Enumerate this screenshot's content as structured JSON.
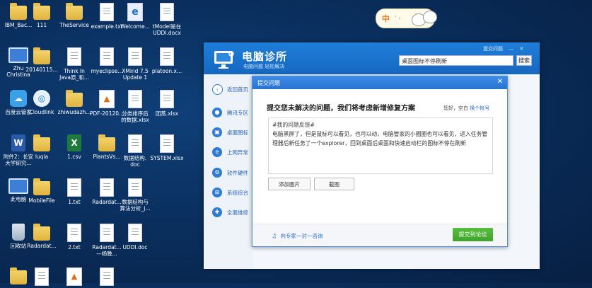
{
  "desktop": {
    "icons": [
      {
        "label": "IBM_Bac...",
        "kind": "folder",
        "icon": "folder-icon"
      },
      {
        "label": "111",
        "kind": "folder",
        "icon": "folder-icon"
      },
      {
        "label": "TheService",
        "kind": "folder",
        "icon": "folder-icon"
      },
      {
        "label": "example.txt",
        "kind": "doc",
        "icon": "text-file-icon"
      },
      {
        "label": "Welcome...",
        "kind": "docblue",
        "icon": "word-document-icon"
      },
      {
        "label": "tModel是在\nUDDI.docx",
        "kind": "doc",
        "icon": "docx-file-icon"
      },
      {
        "label": "Zhu\nChristina",
        "kind": "monitor",
        "icon": "user-folder-icon"
      },
      {
        "label": "20140115...",
        "kind": "folder",
        "icon": "folder-icon"
      },
      {
        "label": "Think In\nJava原_和...",
        "kind": "doc",
        "icon": "file-icon"
      },
      {
        "label": "myeclipse...",
        "kind": "doc",
        "icon": "file-icon"
      },
      {
        "label": "XMind 7.5\nUpdate 1",
        "kind": "doc",
        "icon": "xmind-icon"
      },
      {
        "label": "platoon.x...",
        "kind": "doc",
        "icon": "file-icon"
      },
      {
        "label": "百度云管家",
        "kind": "cloud",
        "icon": "baidu-cloud-icon"
      },
      {
        "label": "Cloudlink",
        "kind": "cloudlink",
        "icon": "cloudlink-icon"
      },
      {
        "label": "zhiwudazh...",
        "kind": "folder",
        "icon": "folder-icon"
      },
      {
        "label": "PDF-20120...",
        "kind": "pdf",
        "icon": "pdf-icon"
      },
      {
        "label": "分类排序后\n的数据.xlsx",
        "kind": "doc",
        "icon": "xlsx-file-icon"
      },
      {
        "label": "团蒸.xlsx",
        "kind": "doc",
        "icon": "xlsx-file-icon"
      },
      {
        "label": "附件2：长安\n大学研究...",
        "kind": "word",
        "icon": "word-icon"
      },
      {
        "label": "luqia",
        "kind": "folder",
        "icon": "folder-icon"
      },
      {
        "label": "1.csv",
        "kind": "excel",
        "icon": "excel-icon"
      },
      {
        "label": "PlantsVs...",
        "kind": "folder",
        "icon": "folder-icon"
      },
      {
        "label": "数据结构.\ndoc",
        "kind": "doc",
        "icon": "doc-file-icon"
      },
      {
        "label": "SYSTEM.xlsx",
        "kind": "doc",
        "icon": "xlsx-file-icon"
      },
      {
        "label": "此电脑",
        "kind": "monitor",
        "icon": "this-pc-icon"
      },
      {
        "label": "MobileFile",
        "kind": "folder",
        "icon": "folder-icon"
      },
      {
        "label": "1.txt",
        "kind": "doc",
        "icon": "text-file-icon"
      },
      {
        "label": "Radardat...",
        "kind": "doc",
        "icon": "file-icon"
      },
      {
        "label": "数据结构与\n算法分析_j...",
        "kind": "doc",
        "icon": "file-icon"
      },
      {
        "label": "回收站",
        "kind": "bin",
        "icon": "recycle-bin-icon"
      },
      {
        "label": "Radardat...",
        "kind": "folder",
        "icon": "folder-icon"
      },
      {
        "label": "2.txt",
        "kind": "doc",
        "icon": "text-file-icon"
      },
      {
        "label": "Radardat...\n—杨晚...",
        "kind": "doc",
        "icon": "file-icon"
      },
      {
        "label": "UDDI.doc",
        "kind": "doc",
        "icon": "doc-file-icon"
      },
      {
        "label": "",
        "kind": "folder",
        "icon": "folder-icon"
      },
      {
        "label": "",
        "kind": "doc",
        "icon": "file-icon"
      },
      {
        "label": "",
        "kind": "pdf",
        "icon": "pdf-icon"
      },
      {
        "label": "",
        "kind": "doc",
        "icon": "file-icon"
      }
    ]
  },
  "widget": {
    "label": "中",
    "dots": "· ,"
  },
  "app": {
    "title": "电脑诊所",
    "subtitle": "电脑问题  轻松解决",
    "header_links": [
      "提交问题",
      "—",
      "✕"
    ],
    "search_value": "桌面图标不停刷新",
    "search_button": "搜索",
    "sidebar": [
      {
        "label": "返回首页",
        "icon": "back-arrow-icon",
        "glyph": "‹"
      },
      {
        "label": "腾讯专区",
        "icon": "penguin-icon",
        "glyph": "●"
      },
      {
        "label": "桌面图标",
        "icon": "desktop-icon",
        "glyph": "▣"
      },
      {
        "label": "上网异常",
        "icon": "ie-icon",
        "glyph": "e"
      },
      {
        "label": "软件硬件",
        "icon": "hardware-icon",
        "glyph": "⚙"
      },
      {
        "label": "系统综合",
        "icon": "windows-icon",
        "glyph": "⊞"
      },
      {
        "label": "全面维修",
        "icon": "repair-icon",
        "glyph": "✚"
      }
    ]
  },
  "dialog": {
    "title": "提交问题",
    "close": "✕",
    "heading": "提交您未解决的问题，我们将考虑新增修复方案",
    "user_text": "您好，空白",
    "switch_account": "换个帐号",
    "tag": "#我的问题反馈#",
    "body": "电脑黑屏了，但是鼠标可以看见，也可以动，电脑管家的小圈圈也可以看见，进入任务管理器后新任务了一个explorer，回到桌面后桌面和快速启动栏的图标不停在刷新",
    "add_image": "添加图片",
    "screenshot": "截图",
    "expert": "向专家一对一咨询",
    "submit": "提交到论坛"
  }
}
